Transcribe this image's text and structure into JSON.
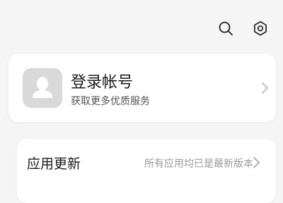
{
  "toolbar": {
    "search_icon": "search-icon",
    "settings_icon": "gear-icon"
  },
  "account": {
    "title": "登录帐号",
    "subtitle": "获取更多优质服务",
    "avatar_icon": "person-icon",
    "chevron_icon": "chevron-right-icon"
  },
  "settings_list": {
    "items": [
      {
        "label": "应用更新",
        "value": "所有应用均已是最新版本",
        "chevron_icon": "chevron-right-icon"
      }
    ]
  },
  "colors": {
    "background": "#f5f5f5",
    "card": "#ffffff",
    "avatar_bg": "#d9d9d9",
    "avatar_figure": "#ffffff",
    "primary_text": "#1a1a1a",
    "secondary_text": "#555555",
    "muted_text": "#9a9a9a"
  }
}
